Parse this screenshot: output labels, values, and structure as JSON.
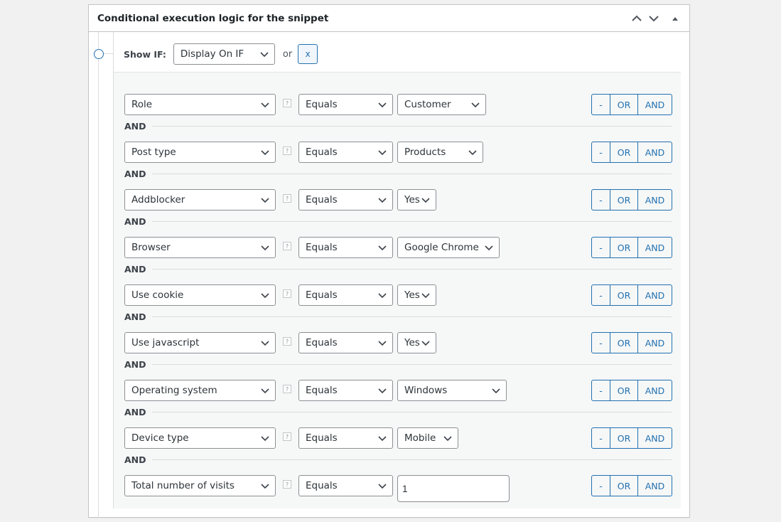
{
  "panel": {
    "title": "Conditional execution logic for the snippet",
    "actions": [
      {
        "name": "move-up-button",
        "icon": "chevron-up-icon"
      },
      {
        "name": "move-down-button",
        "icon": "chevron-down-icon"
      },
      {
        "name": "toggle-panel-button",
        "icon": "triangle-up-icon"
      }
    ]
  },
  "show_if": {
    "label": "Show IF:",
    "selected": "Display On IF",
    "or_label": "or",
    "remove_label": "x"
  },
  "separator_label": "AND",
  "help_glyph": "?",
  "button_group": {
    "remove": "-",
    "or": "OR",
    "and": "AND"
  },
  "rules": [
    {
      "condition": "Role",
      "operator": "Equals",
      "value": "Customer",
      "value_type": "select"
    },
    {
      "condition": "Post type",
      "operator": "Equals",
      "value": "Products",
      "value_type": "select"
    },
    {
      "condition": "Addblocker",
      "operator": "Equals",
      "value": "Yes",
      "value_type": "select"
    },
    {
      "condition": "Browser",
      "operator": "Equals",
      "value": "Google Chrome",
      "value_type": "select"
    },
    {
      "condition": "Use cookie",
      "operator": "Equals",
      "value": "Yes",
      "value_type": "select"
    },
    {
      "condition": "Use javascript",
      "operator": "Equals",
      "value": "Yes",
      "value_type": "select"
    },
    {
      "condition": "Operating system",
      "operator": "Equals",
      "value": "Windows",
      "value_type": "select"
    },
    {
      "condition": "Device type",
      "operator": "Equals",
      "value": "Mobile",
      "value_type": "select"
    },
    {
      "condition": "Total number of visits",
      "operator": "Equals",
      "value": "1",
      "value_type": "input"
    }
  ]
}
